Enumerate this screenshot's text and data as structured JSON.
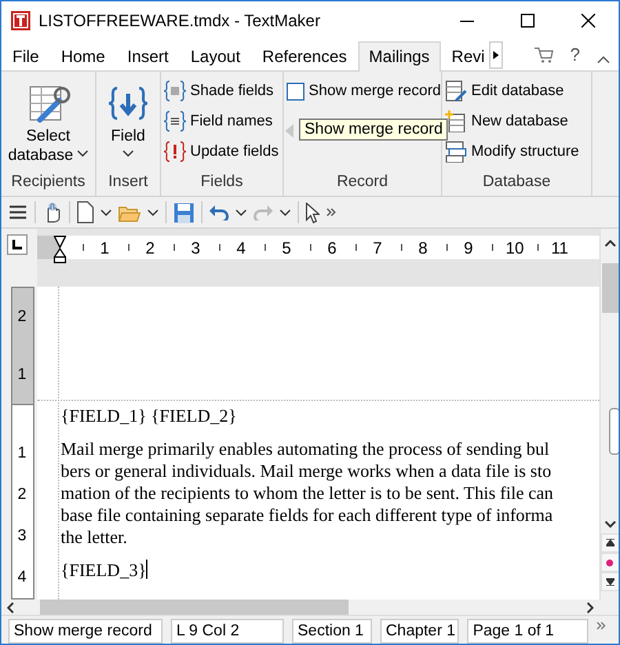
{
  "window": {
    "title": "LISTOFFREEWARE.tmdx - TextMaker"
  },
  "tabs": [
    {
      "label": "File",
      "selected": false
    },
    {
      "label": "Home",
      "selected": false
    },
    {
      "label": "Insert",
      "selected": false
    },
    {
      "label": "Layout",
      "selected": false
    },
    {
      "label": "References",
      "selected": false
    },
    {
      "label": "Mailings",
      "selected": true
    },
    {
      "label": "Revi",
      "selected": false
    }
  ],
  "help": {
    "label": "?"
  },
  "ribbon": {
    "groups": [
      {
        "label": "Recipients",
        "items": [
          {
            "kind": "large",
            "label": "Select database",
            "dropdown": true
          }
        ]
      },
      {
        "label": "Insert",
        "items": [
          {
            "kind": "large",
            "label": "Field",
            "dropdown": true
          }
        ]
      },
      {
        "label": "Fields",
        "items": [
          {
            "kind": "small",
            "label": "Shade fields"
          },
          {
            "kind": "small",
            "label": "Field names"
          },
          {
            "kind": "small",
            "label": "Update fields"
          }
        ]
      },
      {
        "label": "Record",
        "items": [
          {
            "kind": "checkbox",
            "label": "Show merge record",
            "checked": false
          },
          {
            "kind": "nav",
            "disabled": true
          }
        ]
      },
      {
        "label": "Database",
        "items": [
          {
            "kind": "small",
            "label": "Edit database"
          },
          {
            "kind": "small",
            "label": "New database"
          },
          {
            "kind": "small",
            "label": "Modify structure"
          }
        ]
      }
    ]
  },
  "tooltip": {
    "text": "Show merge record"
  },
  "ruler": {
    "h_labels": [
      "1",
      "2",
      "3",
      "4",
      "5",
      "6",
      "7",
      "8",
      "9",
      "10",
      "11"
    ],
    "v_labels_header": [
      "2",
      "1"
    ],
    "v_labels_body": [
      "1",
      "2",
      "3",
      "4"
    ]
  },
  "document": {
    "paragraphs": [
      {
        "kind": "line",
        "text": "{FIELD_1} {FIELD_2}",
        "cursor": false
      },
      {
        "kind": "block",
        "lines": [
          "Mail merge primarily enables automating the process of sending bul",
          "bers or general individuals. Mail merge works when a data file is sto",
          "mation of the recipients to whom the letter is to be sent. This file can",
          "base file containing separate fields for each different type of informa",
          "the letter."
        ]
      },
      {
        "kind": "line",
        "text": "{FIELD_3}",
        "cursor": true
      }
    ]
  },
  "status_bar": [
    "Show merge record",
    "L 9 Col 2",
    "Section 1",
    "Chapter 1",
    "Page 1 of 1"
  ]
}
